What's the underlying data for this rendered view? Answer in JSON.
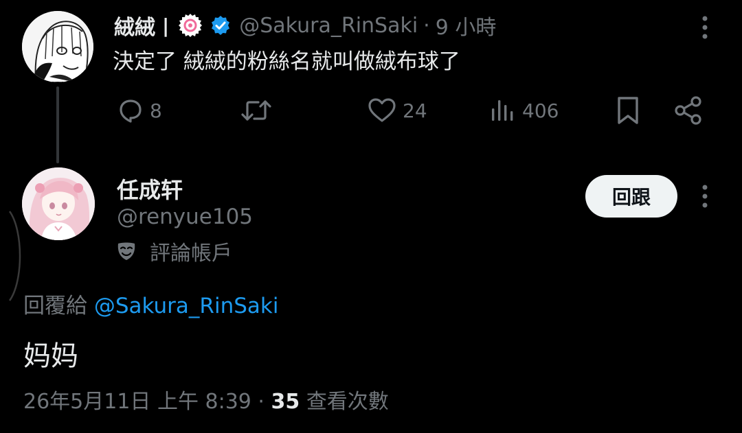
{
  "original_tweet": {
    "author_name": "絨絨",
    "separator": "|",
    "handle": "@Sakura_RinSaki",
    "time_separator": "·",
    "time": "9 小時",
    "text": "決定了 絨絨的粉絲名就叫做絨布球了",
    "actions": {
      "replies": "8",
      "retweets": "",
      "likes": "24",
      "views": "406"
    }
  },
  "reply": {
    "display_name": "任成轩",
    "handle": "@renyue105",
    "account_note": "評論帳戶",
    "follow_button_label": "回跟",
    "reply_to_label": "回覆給",
    "reply_to_handle": "@Sakura_RinSaki",
    "text": "妈妈",
    "timestamp": "26年5月11日 上午 8:39",
    "meta_separator": "·",
    "view_count": "35",
    "view_label": "查看次數"
  },
  "colors": {
    "background": "#000000",
    "primary_text": "#e7e9ea",
    "secondary_text": "#71767b",
    "accent": "#1d9bf0",
    "verified": "#1d9bf0",
    "button_bg": "#eff3f4"
  },
  "icons": [
    "reply-icon",
    "retweet-icon",
    "like-icon",
    "views-icon",
    "bookmark-icon",
    "share-icon",
    "more-icon",
    "verified-icon",
    "narutomaki-badge-icon",
    "mask-icon"
  ]
}
